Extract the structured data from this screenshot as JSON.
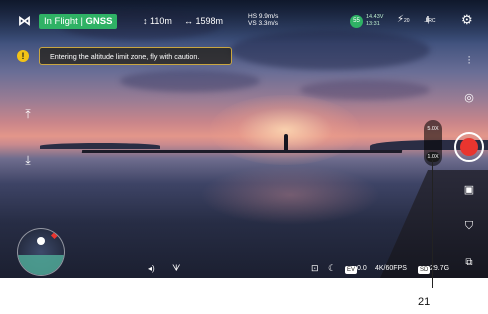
{
  "status_bar": {
    "flight_mode": "In Flight",
    "gnss": "GNSS",
    "altitude": "110m",
    "distance": "1598m",
    "hs": "HS  9.9m/s",
    "vs": "VS  3.3m/s",
    "battery_percent": "55",
    "battery_voltage": "14.43V",
    "flight_time": "13:31",
    "gps_count": "20",
    "signal_label": "RC"
  },
  "warning": {
    "text": "Entering the altitude limit zone, fly with caution."
  },
  "zoom": {
    "top_label": "5.0X",
    "current_label": "1.0X"
  },
  "bottom_bar": {
    "ev_label": "EV",
    "ev_value": "0.0",
    "resolution": "4K/60FPS",
    "storage_label": "SD",
    "storage_value": "29.7G"
  },
  "callout": {
    "number": "21"
  },
  "colors": {
    "flight_badge": "#2fb265",
    "shutter": "#e9352f",
    "warning_border": "#c9a640",
    "battery": "#2fb265"
  }
}
